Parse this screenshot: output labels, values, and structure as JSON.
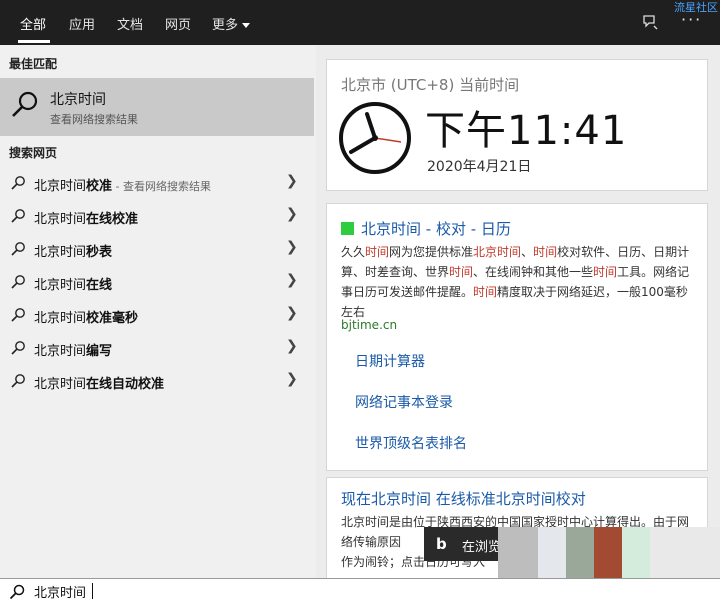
{
  "tabs": [
    {
      "label": "全部",
      "active": true
    },
    {
      "label": "应用",
      "active": false
    },
    {
      "label": "文档",
      "active": false
    },
    {
      "label": "网页",
      "active": false
    },
    {
      "label": "更多",
      "active": false
    }
  ],
  "topbar": {
    "watermark": "流星社区"
  },
  "left": {
    "best_match_label": "最佳匹配",
    "best_match": {
      "title": "北京时间",
      "subtitle": "查看网络搜索结果"
    },
    "search_web_label": "搜索网页",
    "suggestions": [
      {
        "prefix": "北京时间",
        "bold": "校准",
        "hint": " - 查看网络搜索结果"
      },
      {
        "prefix": "北京时间",
        "bold": "在线校准",
        "hint": ""
      },
      {
        "prefix": "北京时间",
        "bold": "秒表",
        "hint": ""
      },
      {
        "prefix": "北京时间",
        "bold": "在线",
        "hint": ""
      },
      {
        "prefix": "北京时间",
        "bold": "校准毫秒",
        "hint": ""
      },
      {
        "prefix": "北京时间",
        "bold": "编写",
        "hint": ""
      },
      {
        "prefix": "北京时间",
        "bold": "在线自动校准",
        "hint": ""
      }
    ]
  },
  "clock": {
    "city": "北京市 (UTC+8) 当前时间",
    "time": "下午11:41",
    "date": "2020年4月21日"
  },
  "result1": {
    "title": "北京时间 - 校对 - 日历",
    "body_html": "久久<span class='hl'>时间</span>网为您提供标准<span class='hl'>北京时间</span>、<span class='hl'>时间</span>校对软件、日历、日期计算、时差查询、世界<span class='hl'>时间</span>、在线闹钟和其他一些<span class='hl'>时间</span>工具。网络记事日历可发送邮件提醒。<span class='hl'>时间</span>精度取决于网络延迟，一般100毫秒左右",
    "url": "bjtime.cn",
    "links": [
      "日期计算器",
      "网络记事本登录",
      "世界顶级名表排名"
    ]
  },
  "result2": {
    "title": "现在北京时间 在线标准北京时间校对",
    "body_html": "<span class='hl'>北京时间</span>是由位于陕西西安的中国国家授时中心计算得出。由于网络传输原因　　　　　　　　　　　毫秒级误差；点击这里进入　　　　　　　　　　　　　　　作为闹铃；点击日历可写入"
  },
  "bing_tip": {
    "logo": "b",
    "text": "在浏览器"
  },
  "search": {
    "value": "北京时间"
  }
}
